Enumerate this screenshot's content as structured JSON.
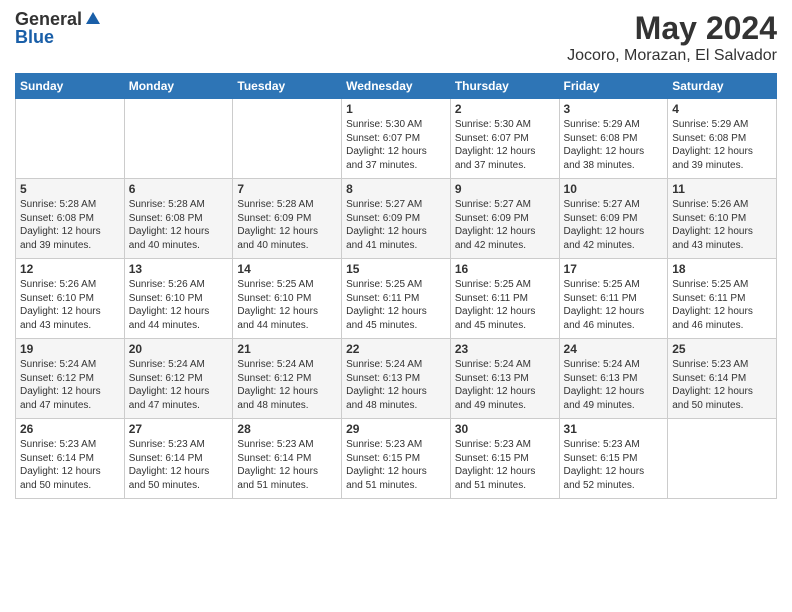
{
  "header": {
    "logo_general": "General",
    "logo_blue": "Blue",
    "month_year": "May 2024",
    "location": "Jocoro, Morazan, El Salvador"
  },
  "weekdays": [
    "Sunday",
    "Monday",
    "Tuesday",
    "Wednesday",
    "Thursday",
    "Friday",
    "Saturday"
  ],
  "weeks": [
    [
      {
        "day": "",
        "info": ""
      },
      {
        "day": "",
        "info": ""
      },
      {
        "day": "",
        "info": ""
      },
      {
        "day": "1",
        "info": "Sunrise: 5:30 AM\nSunset: 6:07 PM\nDaylight: 12 hours\nand 37 minutes."
      },
      {
        "day": "2",
        "info": "Sunrise: 5:30 AM\nSunset: 6:07 PM\nDaylight: 12 hours\nand 37 minutes."
      },
      {
        "day": "3",
        "info": "Sunrise: 5:29 AM\nSunset: 6:08 PM\nDaylight: 12 hours\nand 38 minutes."
      },
      {
        "day": "4",
        "info": "Sunrise: 5:29 AM\nSunset: 6:08 PM\nDaylight: 12 hours\nand 39 minutes."
      }
    ],
    [
      {
        "day": "5",
        "info": "Sunrise: 5:28 AM\nSunset: 6:08 PM\nDaylight: 12 hours\nand 39 minutes."
      },
      {
        "day": "6",
        "info": "Sunrise: 5:28 AM\nSunset: 6:08 PM\nDaylight: 12 hours\nand 40 minutes."
      },
      {
        "day": "7",
        "info": "Sunrise: 5:28 AM\nSunset: 6:09 PM\nDaylight: 12 hours\nand 40 minutes."
      },
      {
        "day": "8",
        "info": "Sunrise: 5:27 AM\nSunset: 6:09 PM\nDaylight: 12 hours\nand 41 minutes."
      },
      {
        "day": "9",
        "info": "Sunrise: 5:27 AM\nSunset: 6:09 PM\nDaylight: 12 hours\nand 42 minutes."
      },
      {
        "day": "10",
        "info": "Sunrise: 5:27 AM\nSunset: 6:09 PM\nDaylight: 12 hours\nand 42 minutes."
      },
      {
        "day": "11",
        "info": "Sunrise: 5:26 AM\nSunset: 6:10 PM\nDaylight: 12 hours\nand 43 minutes."
      }
    ],
    [
      {
        "day": "12",
        "info": "Sunrise: 5:26 AM\nSunset: 6:10 PM\nDaylight: 12 hours\nand 43 minutes."
      },
      {
        "day": "13",
        "info": "Sunrise: 5:26 AM\nSunset: 6:10 PM\nDaylight: 12 hours\nand 44 minutes."
      },
      {
        "day": "14",
        "info": "Sunrise: 5:25 AM\nSunset: 6:10 PM\nDaylight: 12 hours\nand 44 minutes."
      },
      {
        "day": "15",
        "info": "Sunrise: 5:25 AM\nSunset: 6:11 PM\nDaylight: 12 hours\nand 45 minutes."
      },
      {
        "day": "16",
        "info": "Sunrise: 5:25 AM\nSunset: 6:11 PM\nDaylight: 12 hours\nand 45 minutes."
      },
      {
        "day": "17",
        "info": "Sunrise: 5:25 AM\nSunset: 6:11 PM\nDaylight: 12 hours\nand 46 minutes."
      },
      {
        "day": "18",
        "info": "Sunrise: 5:25 AM\nSunset: 6:11 PM\nDaylight: 12 hours\nand 46 minutes."
      }
    ],
    [
      {
        "day": "19",
        "info": "Sunrise: 5:24 AM\nSunset: 6:12 PM\nDaylight: 12 hours\nand 47 minutes."
      },
      {
        "day": "20",
        "info": "Sunrise: 5:24 AM\nSunset: 6:12 PM\nDaylight: 12 hours\nand 47 minutes."
      },
      {
        "day": "21",
        "info": "Sunrise: 5:24 AM\nSunset: 6:12 PM\nDaylight: 12 hours\nand 48 minutes."
      },
      {
        "day": "22",
        "info": "Sunrise: 5:24 AM\nSunset: 6:13 PM\nDaylight: 12 hours\nand 48 minutes."
      },
      {
        "day": "23",
        "info": "Sunrise: 5:24 AM\nSunset: 6:13 PM\nDaylight: 12 hours\nand 49 minutes."
      },
      {
        "day": "24",
        "info": "Sunrise: 5:24 AM\nSunset: 6:13 PM\nDaylight: 12 hours\nand 49 minutes."
      },
      {
        "day": "25",
        "info": "Sunrise: 5:23 AM\nSunset: 6:14 PM\nDaylight: 12 hours\nand 50 minutes."
      }
    ],
    [
      {
        "day": "26",
        "info": "Sunrise: 5:23 AM\nSunset: 6:14 PM\nDaylight: 12 hours\nand 50 minutes."
      },
      {
        "day": "27",
        "info": "Sunrise: 5:23 AM\nSunset: 6:14 PM\nDaylight: 12 hours\nand 50 minutes."
      },
      {
        "day": "28",
        "info": "Sunrise: 5:23 AM\nSunset: 6:14 PM\nDaylight: 12 hours\nand 51 minutes."
      },
      {
        "day": "29",
        "info": "Sunrise: 5:23 AM\nSunset: 6:15 PM\nDaylight: 12 hours\nand 51 minutes."
      },
      {
        "day": "30",
        "info": "Sunrise: 5:23 AM\nSunset: 6:15 PM\nDaylight: 12 hours\nand 51 minutes."
      },
      {
        "day": "31",
        "info": "Sunrise: 5:23 AM\nSunset: 6:15 PM\nDaylight: 12 hours\nand 52 minutes."
      },
      {
        "day": "",
        "info": ""
      }
    ]
  ]
}
